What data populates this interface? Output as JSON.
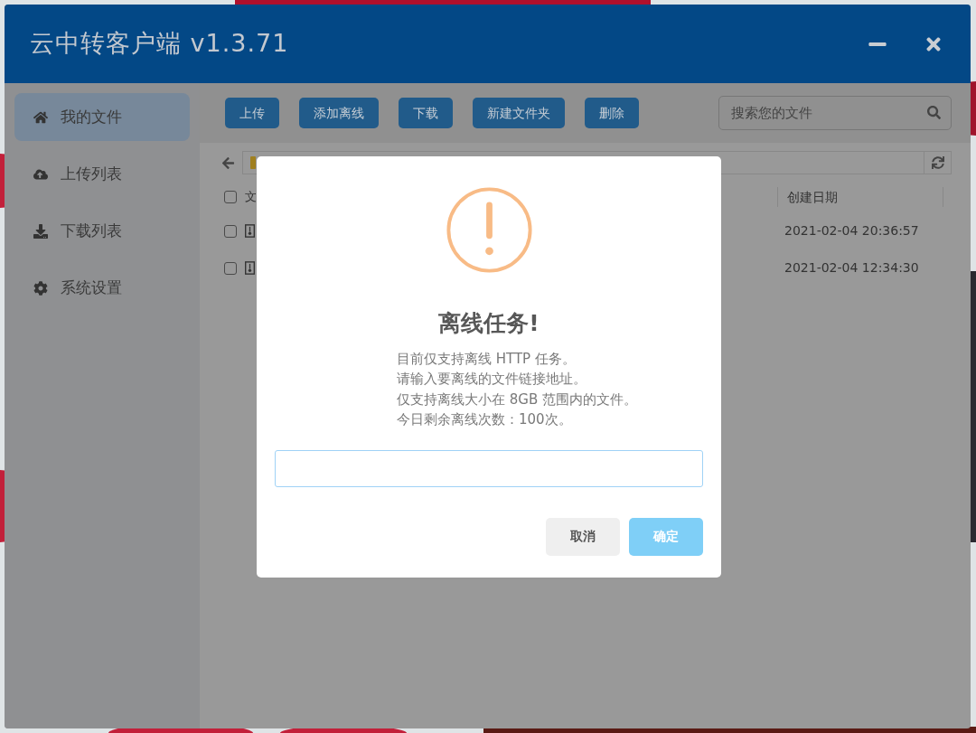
{
  "window": {
    "title": "云中转客户端 v1.3.71"
  },
  "sidebar": {
    "items": [
      {
        "label": "我的文件",
        "selected": true
      },
      {
        "label": "上传列表",
        "selected": false
      },
      {
        "label": "下载列表",
        "selected": false
      },
      {
        "label": "系统设置",
        "selected": false
      }
    ]
  },
  "toolbar": {
    "buttons": [
      "上传",
      "添加离线",
      "下载",
      "新建文件夹",
      "删除"
    ]
  },
  "search": {
    "placeholder": "搜索您的文件"
  },
  "table": {
    "select_all": {
      "checked": false
    },
    "columns": [
      "文",
      "创建日期"
    ],
    "rows": [
      {
        "checked": false,
        "date": "2021-02-04 20:36:57"
      },
      {
        "checked": false,
        "date": "2021-02-04 12:34:30"
      }
    ]
  },
  "dialog": {
    "title": "离线任务!",
    "lines": [
      "目前仅支持离线 HTTP 任务。",
      "请输入要离线的文件链接地址。",
      "仅支持离线大小在 8GB 范围内的文件。",
      "今日剩余离线次数：100次。"
    ],
    "buttons": [
      {
        "label": "取消",
        "kind": "cancel"
      },
      {
        "label": "确定",
        "kind": "confirm"
      }
    ]
  }
}
